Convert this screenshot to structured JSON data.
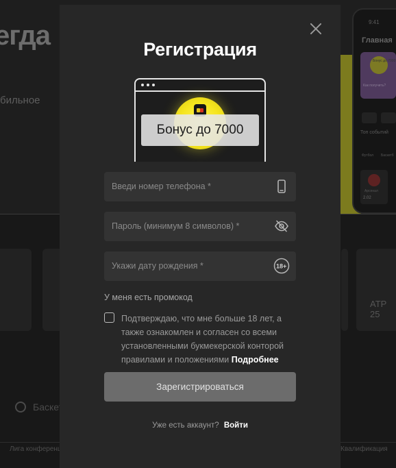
{
  "background": {
    "hero_title": "егда",
    "hero_sub": "бильное",
    "atp_label": "ATP 25",
    "sport_label": "Баскет",
    "tab_left": "Лига конференц",
    "tab_right": "Квалификация",
    "phone": {
      "time": "9:41",
      "home": "Главная",
      "promo": "Бонус до 7000",
      "promo_q": "Как получить?",
      "events": "Топ событий",
      "sport1": "Футбол",
      "sport2": "Баскетб",
      "team": "Арсенал",
      "odd": "2.02"
    }
  },
  "modal": {
    "title": "Регистрация",
    "banner_text": "Бонус до 7000",
    "phone_placeholder": "Введи номер телефона *",
    "password_placeholder": "Пароль (минимум 8 символов) *",
    "birthdate_placeholder": "Укажи дату рождения *",
    "age_badge": "18+",
    "promo_link": "У меня есть промокод",
    "consent_text": "Подтверждаю, что мне больше 18 лет, а также ознакомлен и согласен со всеми установленными букмекерской конторой правилами и положениями",
    "consent_more": "Подробнее",
    "submit_label": "Зарегистрироваться",
    "have_account": "Уже есть аккаунт?",
    "login_label": "Войти"
  },
  "icons": {
    "close": "close-icon",
    "phone": "smartphone-icon",
    "eye": "eye-slash-icon",
    "age": "age-18-icon"
  },
  "colors": {
    "modal_bg": "#272727",
    "field_bg": "#333333",
    "submit_bg": "#6c6c6c",
    "accent_yellow": "#f5e51e"
  }
}
